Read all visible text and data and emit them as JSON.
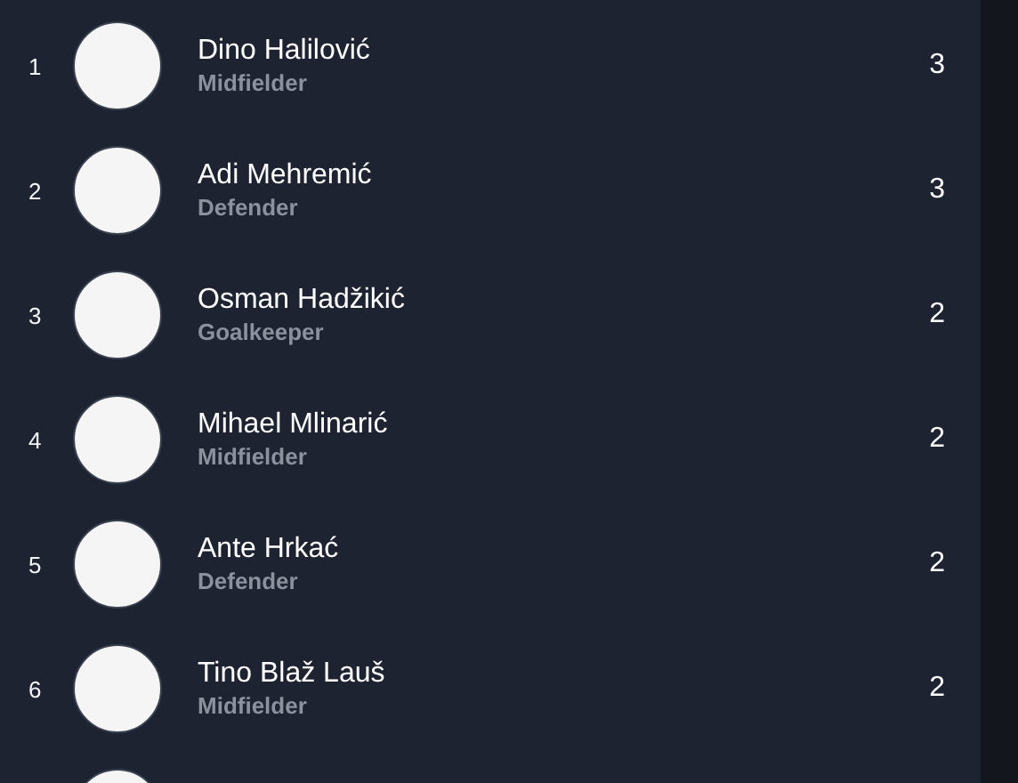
{
  "players": [
    {
      "rank": "1",
      "name": "Dino Halilović",
      "position": "Midfielder",
      "value": "3"
    },
    {
      "rank": "2",
      "name": "Adi Mehremić",
      "position": "Defender",
      "value": "3"
    },
    {
      "rank": "3",
      "name": "Osman Hadžikić",
      "position": "Goalkeeper",
      "value": "2"
    },
    {
      "rank": "4",
      "name": "Mihael Mlinarić",
      "position": "Midfielder",
      "value": "2"
    },
    {
      "rank": "5",
      "name": "Ante Hrkać",
      "position": "Defender",
      "value": "2"
    },
    {
      "rank": "6",
      "name": "Tino Blaž Lauš",
      "position": "Midfielder",
      "value": "2"
    }
  ]
}
